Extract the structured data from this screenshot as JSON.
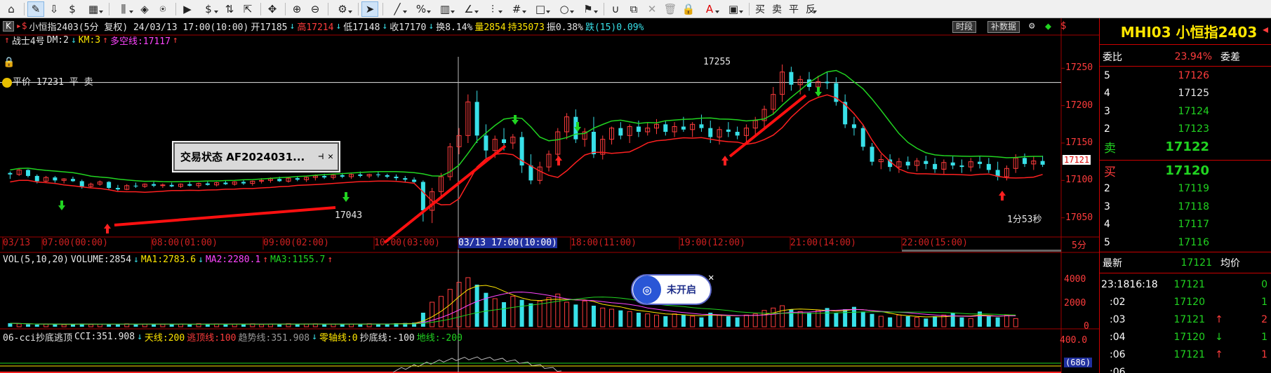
{
  "toolbar": {
    "buttons": [
      {
        "name": "home-icon",
        "glyph": "⌂"
      },
      {
        "sep": true
      },
      {
        "name": "draw-icon",
        "glyph": "✎",
        "active": true
      },
      {
        "name": "download-icon",
        "glyph": "⇩"
      },
      {
        "name": "dollar-cycle-icon",
        "glyph": "$"
      },
      {
        "name": "grid-layout-icon",
        "glyph": "▦",
        "drop": true
      },
      {
        "sep": true
      },
      {
        "name": "bar-chart-icon",
        "glyph": "⫼",
        "drop": true
      },
      {
        "name": "diamond-icon",
        "glyph": "◈"
      },
      {
        "name": "indicator-icon",
        "glyph": "⍟"
      },
      {
        "sep": true
      },
      {
        "name": "play-icon",
        "glyph": "▶"
      },
      {
        "name": "currency-icon",
        "glyph": "$",
        "drop": true
      },
      {
        "name": "arrange-icon",
        "glyph": "⇅"
      },
      {
        "name": "expand-icon",
        "glyph": "⇱"
      },
      {
        "sep": true
      },
      {
        "name": "move-icon",
        "glyph": "✥"
      },
      {
        "sep": true
      },
      {
        "name": "zoom-in-icon",
        "glyph": "⊕"
      },
      {
        "name": "zoom-out-icon",
        "glyph": "⊖"
      },
      {
        "sep": true
      },
      {
        "name": "settings-icon",
        "glyph": "⚙",
        "drop": true
      },
      {
        "sep": true
      },
      {
        "name": "cursor-icon",
        "glyph": "➤",
        "active": true
      },
      {
        "sep": true
      },
      {
        "name": "line-tool-icon",
        "glyph": "╱",
        "drop": true
      },
      {
        "name": "percent-tool-icon",
        "glyph": "%",
        "drop": true
      },
      {
        "name": "table-tool-icon",
        "glyph": "▥",
        "drop": true
      },
      {
        "name": "angle-tool-icon",
        "glyph": "∠",
        "drop": true
      },
      {
        "name": "level-tool-icon",
        "glyph": "⫶",
        "drop": true
      },
      {
        "name": "hash-tool-icon",
        "glyph": "#",
        "drop": true
      },
      {
        "name": "rect-tool-icon",
        "glyph": "□",
        "drop": true
      },
      {
        "name": "circle-tool-icon",
        "glyph": "○",
        "drop": true
      },
      {
        "name": "marker-tool-icon",
        "glyph": "⚑",
        "drop": true
      },
      {
        "sep": true
      },
      {
        "name": "magnet-icon",
        "glyph": "∪"
      },
      {
        "name": "copy-icon",
        "glyph": "⧉"
      },
      {
        "name": "delete-icon",
        "glyph": "✕",
        "disabled": true
      },
      {
        "name": "trash-icon",
        "glyph": "🗑",
        "disabled": true
      },
      {
        "name": "lock-icon",
        "glyph": "🔒"
      },
      {
        "name": "text-color-icon",
        "glyph": "A",
        "drop": true,
        "color": "#d00"
      },
      {
        "name": "save-icon",
        "glyph": "▣",
        "drop": true
      },
      {
        "sep": true
      },
      {
        "name": "buy-button",
        "glyph": "买",
        "cn": true
      },
      {
        "name": "sell-button",
        "glyph": "卖",
        "cn": true
      },
      {
        "name": "close-position-button",
        "glyph": "平",
        "cn": true
      },
      {
        "name": "reverse-button",
        "glyph": "反",
        "cn": true,
        "drop": true
      }
    ]
  },
  "header": {
    "k_badge": "K",
    "symbol_title": "小恒指2403(5分 复权) 24/03/13 17:00(10:00)",
    "open": "开17185",
    "high": "高17214",
    "low": "低17148",
    "close": "收17170",
    "turnover": "换8.14%",
    "volume": "量2854",
    "open_interest": "持35073",
    "amplitude": "振0.38%",
    "change": "跌(15)0.09%",
    "btn_timeshare": "时段",
    "btn_supplement": "补数据"
  },
  "strategy": {
    "name": "战士4号",
    "dm": "DM:2",
    "km": "KM:3",
    "dkx": "多空线:17117"
  },
  "price_note": "平价 17231 平 卖",
  "status_box": {
    "title": "交易状态 AF2024031..."
  },
  "float_widget": {
    "label": "未开启"
  },
  "timer_text": "1分53秒",
  "period_label": "5分",
  "price_marks": {
    "high_mark": "17255",
    "low_mark": "17043",
    "current": "17121"
  },
  "y_axis_main": [
    "17250",
    "17200",
    "17150",
    "17100",
    "17050"
  ],
  "x_axis": [
    {
      "label": "03/13"
    },
    {
      "label": "07:00(00:00)"
    },
    {
      "label": "08:00(01:00)"
    },
    {
      "label": "09:00(02:00)"
    },
    {
      "label": "10:00(03:00)"
    },
    {
      "label": "03/13 17:00(10:00)",
      "highlight": true
    },
    {
      "label": "18:00(11:00)"
    },
    {
      "label": "19:00(12:00)"
    },
    {
      "label": "21:00(14:00)"
    },
    {
      "label": "22:00(15:00)"
    }
  ],
  "volume_pane": {
    "title": "VOL(5,10,20)",
    "volume": "VOLUME:2854",
    "ma1": "MA1:2783.6",
    "ma2": "MA2:2280.1",
    "ma3": "MA3:1155.7",
    "y_axis": [
      "4000",
      "2000",
      "0"
    ]
  },
  "cci_pane": {
    "title": "06-cci抄底逃顶",
    "cci": "CCI:351.908",
    "sky": "天线:200",
    "escape": "逃顶线:100",
    "trend": "趋势线:351.908",
    "zero": "零轴线:0",
    "bottom": "抄底线:-100",
    "ground": "地线:-200",
    "y_axis": [
      "400.0"
    ],
    "badge": "(686)"
  },
  "order_book": {
    "title": "MHI03 小恒指2403",
    "ratio_label": "委比",
    "ratio_value": "23.94%",
    "diff_label": "委差",
    "asks": [
      {
        "level": "5",
        "price": "17126",
        "color": "#ff3c3c"
      },
      {
        "level": "4",
        "price": "17125",
        "color": "#e6e6e6"
      },
      {
        "level": "3",
        "price": "17124",
        "color": "#21d421"
      },
      {
        "level": "2",
        "price": "17123",
        "color": "#21d421"
      },
      {
        "level": "卖",
        "price": "17122",
        "color": "#21d421"
      }
    ],
    "bids": [
      {
        "level": "买",
        "price": "17120",
        "color": "#21d421"
      },
      {
        "level": "2",
        "price": "17119",
        "color": "#21d421"
      },
      {
        "level": "3",
        "price": "17118",
        "color": "#21d421"
      },
      {
        "level": "4",
        "price": "17117",
        "color": "#21d421"
      },
      {
        "level": "5",
        "price": "17116",
        "color": "#21d421"
      }
    ],
    "latest_label": "最新",
    "latest_value": "17121",
    "avg_label": "均价"
  },
  "ticks": [
    {
      "time": "23:18",
      "time2": "16:18",
      "price": "17121",
      "qty": "0",
      "color": "#21d421",
      "qcolor": "#21d421",
      "arrow": ""
    },
    {
      "time": ":02",
      "price": "17120",
      "qty": "1",
      "color": "#21d421",
      "qcolor": "#21d421",
      "arrow": ""
    },
    {
      "time": ":03",
      "price": "17121",
      "qty": "2",
      "color": "#21d421",
      "qcolor": "#ff3c3c",
      "arrow": "↑",
      "acolor": "#ff3c3c"
    },
    {
      "time": ":04",
      "price": "17120",
      "qty": "1",
      "color": "#21d421",
      "qcolor": "#21d421",
      "arrow": "↓",
      "acolor": "#21d421"
    },
    {
      "time": ":06",
      "price": "17121",
      "qty": "1",
      "color": "#21d421",
      "qcolor": "#ff3c3c",
      "arrow": "↑",
      "acolor": "#ff3c3c"
    },
    {
      "time": ":06",
      "price": "",
      "qty": "",
      "color": "#21d421",
      "arrow": ""
    }
  ],
  "colors": {
    "up": "#ff3c3c",
    "down": "#38e0e8",
    "green_line": "#21d421",
    "grid_red": "#a00000"
  },
  "candles": [
    [
      17110,
      17112,
      17102,
      17108
    ],
    [
      17108,
      17116,
      17106,
      17114
    ],
    [
      17114,
      17115,
      17104,
      17106
    ],
    [
      17106,
      17108,
      17096,
      17099
    ],
    [
      17099,
      17106,
      17097,
      17104
    ],
    [
      17104,
      17106,
      17097,
      17100
    ],
    [
      17100,
      17103,
      17096,
      17102
    ],
    [
      17102,
      17105,
      17098,
      17099
    ],
    [
      17099,
      17101,
      17089,
      17092
    ],
    [
      17092,
      17097,
      17090,
      17095
    ],
    [
      17095,
      17100,
      17093,
      17098
    ],
    [
      17098,
      17099,
      17088,
      17090
    ],
    [
      17090,
      17094,
      17086,
      17088
    ],
    [
      17088,
      17095,
      17087,
      17093
    ],
    [
      17093,
      17097,
      17090,
      17092
    ],
    [
      17092,
      17096,
      17090,
      17095
    ],
    [
      17095,
      17098,
      17091,
      17093
    ],
    [
      17093,
      17096,
      17090,
      17094
    ],
    [
      17094,
      17097,
      17091,
      17092
    ],
    [
      17092,
      17096,
      17090,
      17095
    ],
    [
      17095,
      17098,
      17092,
      17093
    ],
    [
      17093,
      17097,
      17090,
      17096
    ],
    [
      17096,
      17099,
      17093,
      17094
    ],
    [
      17094,
      17098,
      17092,
      17097
    ],
    [
      17097,
      17100,
      17094,
      17095
    ],
    [
      17095,
      17099,
      17093,
      17098
    ],
    [
      17098,
      17101,
      17094,
      17096
    ],
    [
      17096,
      17100,
      17093,
      17099
    ],
    [
      17099,
      17103,
      17096,
      17100
    ],
    [
      17100,
      17104,
      17097,
      17102
    ],
    [
      17102,
      17105,
      17098,
      17099
    ],
    [
      17099,
      17104,
      17097,
      17103
    ],
    [
      17103,
      17106,
      17099,
      17101
    ],
    [
      17101,
      17105,
      17098,
      17104
    ],
    [
      17104,
      17108,
      17100,
      17106
    ],
    [
      17106,
      17109,
      17102,
      17104
    ],
    [
      17104,
      17108,
      17101,
      17107
    ],
    [
      17107,
      17110,
      17103,
      17105
    ],
    [
      17105,
      17109,
      17102,
      17108
    ],
    [
      17108,
      17112,
      17104,
      17106
    ],
    [
      17106,
      17109,
      17103,
      17108
    ],
    [
      17108,
      17111,
      17104,
      17107
    ],
    [
      17107,
      17109,
      17103,
      17105
    ],
    [
      17105,
      17108,
      17100,
      17103
    ],
    [
      17103,
      17106,
      17098,
      17101
    ],
    [
      17101,
      17104,
      17096,
      17098
    ],
    [
      17098,
      17100,
      17045,
      17060
    ],
    [
      17060,
      17090,
      17043,
      17085
    ],
    [
      17085,
      17110,
      17075,
      17105
    ],
    [
      17105,
      17150,
      17100,
      17145
    ],
    [
      17145,
      17170,
      17135,
      17160
    ],
    [
      17160,
      17215,
      17150,
      17205
    ],
    [
      17205,
      17220,
      17150,
      17160
    ],
    [
      17160,
      17175,
      17130,
      17140
    ],
    [
      17140,
      17160,
      17130,
      17155
    ],
    [
      17155,
      17170,
      17140,
      17150
    ],
    [
      17150,
      17162,
      17142,
      17158
    ],
    [
      17158,
      17165,
      17110,
      17120
    ],
    [
      17120,
      17135,
      17095,
      17100
    ],
    [
      17100,
      17125,
      17095,
      17118
    ],
    [
      17118,
      17140,
      17112,
      17135
    ],
    [
      17135,
      17170,
      17128,
      17165
    ],
    [
      17165,
      17190,
      17155,
      17185
    ],
    [
      17185,
      17195,
      17150,
      17155
    ],
    [
      17155,
      17170,
      17145,
      17165
    ],
    [
      17165,
      17185,
      17130,
      17135
    ],
    [
      17135,
      17160,
      17128,
      17155
    ],
    [
      17155,
      17172,
      17148,
      17170
    ],
    [
      17170,
      17178,
      17155,
      17160
    ],
    [
      17160,
      17175,
      17150,
      17172
    ],
    [
      17172,
      17180,
      17158,
      17165
    ],
    [
      17165,
      17178,
      17160,
      17170
    ],
    [
      17170,
      17182,
      17162,
      17175
    ],
    [
      17175,
      17180,
      17160,
      17165
    ],
    [
      17165,
      17178,
      17158,
      17172
    ],
    [
      17172,
      17185,
      17165,
      17168
    ],
    [
      17168,
      17178,
      17158,
      17175
    ],
    [
      17175,
      17188,
      17165,
      17170
    ],
    [
      17170,
      17180,
      17150,
      17158
    ],
    [
      17158,
      17172,
      17148,
      17168
    ],
    [
      17168,
      17178,
      17158,
      17165
    ],
    [
      17165,
      17172,
      17155,
      17160
    ],
    [
      17160,
      17175,
      17150,
      17170
    ],
    [
      17170,
      17185,
      17160,
      17180
    ],
    [
      17180,
      17200,
      17170,
      17195
    ],
    [
      17195,
      17225,
      17188,
      17215
    ],
    [
      17215,
      17255,
      17205,
      17245
    ],
    [
      17245,
      17252,
      17220,
      17228
    ],
    [
      17228,
      17240,
      17215,
      17235
    ],
    [
      17235,
      17245,
      17220,
      17225
    ],
    [
      17225,
      17240,
      17215,
      17232
    ],
    [
      17232,
      17245,
      17222,
      17230
    ],
    [
      17230,
      17238,
      17200,
      17205
    ],
    [
      17205,
      17215,
      17170,
      17175
    ],
    [
      17175,
      17185,
      17160,
      17170
    ],
    [
      17170,
      17175,
      17140,
      17145
    ],
    [
      17145,
      17150,
      17120,
      17125
    ],
    [
      17125,
      17135,
      17115,
      17128
    ],
    [
      17128,
      17135,
      17112,
      17118
    ],
    [
      17118,
      17130,
      17110,
      17125
    ],
    [
      17125,
      17132,
      17115,
      17120
    ],
    [
      17120,
      17130,
      17112,
      17126
    ],
    [
      17126,
      17133,
      17115,
      17122
    ],
    [
      17122,
      17130,
      17110,
      17115
    ],
    [
      17115,
      17128,
      17108,
      17124
    ],
    [
      17124,
      17132,
      17115,
      17120
    ],
    [
      17120,
      17128,
      17110,
      17118
    ],
    [
      17118,
      17130,
      17112,
      17125
    ],
    [
      17125,
      17133,
      17116,
      17122
    ],
    [
      17122,
      17130,
      17110,
      17114
    ],
    [
      17114,
      17125,
      17100,
      17105
    ],
    [
      17105,
      17120,
      17100,
      17116
    ],
    [
      17116,
      17135,
      17110,
      17130
    ],
    [
      17130,
      17136,
      17118,
      17122
    ],
    [
      17122,
      17132,
      17114,
      17126
    ],
    [
      17126,
      17133,
      17118,
      17121
    ]
  ],
  "volumes": [
    300,
    250,
    200,
    180,
    220,
    240,
    180,
    200,
    260,
    190,
    210,
    230,
    200,
    250,
    190,
    220,
    240,
    200,
    230,
    210,
    190,
    260,
    220,
    240,
    200,
    210,
    230,
    250,
    190,
    220,
    240,
    260,
    210,
    230,
    250,
    200,
    220,
    240,
    210,
    230,
    260,
    220,
    250,
    300,
    320,
    350,
    1200,
    2100,
    2600,
    3200,
    3800,
    4200,
    3600,
    2900,
    2400,
    2100,
    2600,
    2300,
    2000,
    2200,
    2500,
    2800,
    2100,
    1900,
    2200,
    1800,
    1600,
    1500,
    1400,
    1300,
    1200,
    1100,
    1000,
    900,
    1100,
    1000,
    900,
    800,
    1200,
    1000,
    900,
    800,
    1000,
    1100,
    1400,
    1600,
    1800,
    1500,
    1300,
    1200,
    1400,
    1600,
    1200,
    1500,
    1700,
    1300,
    1100,
    900,
    800,
    1000,
    900,
    800,
    700,
    900,
    1000,
    1200,
    800,
    700,
    1300,
    900,
    800,
    1000,
    700
  ]
}
